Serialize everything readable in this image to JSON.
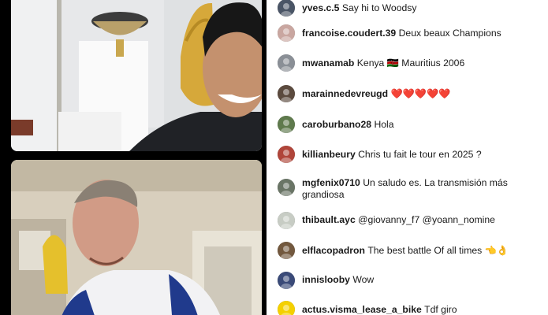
{
  "comments": [
    {
      "user": "yves.c.5",
      "text": "Say hi to Woodsy",
      "avatar_color": "#4a5566"
    },
    {
      "user": "francoise.coudert.39",
      "text": "Deux beaux Champions",
      "avatar_color": "#c9a6a0"
    },
    {
      "user": "mwanamab",
      "text": "Kenya 🇰🇪 Mauritius 2006",
      "avatar_color": "#8a8f96"
    },
    {
      "user": "marainnedevreugd",
      "text": "❤️❤️❤️❤️❤️",
      "avatar_color": "#5b4a3e"
    },
    {
      "user": "caroburbano28",
      "text": "Hola",
      "avatar_color": "#5f7a4d"
    },
    {
      "user": "killianbeury",
      "text": "Chris tu fait le tour en 2025 ?",
      "avatar_color": "#b0453a"
    },
    {
      "user": "mgfenix0710",
      "text": "Un saludo es. La transmisión más grandiosa",
      "avatar_color": "#6a7566"
    },
    {
      "user": "thibault.ayc",
      "text": "@giovanny_f7 @yoann_nomine",
      "avatar_color": "#c7ccc4"
    },
    {
      "user": "elflacopadron",
      "text": "The best battle Of all times 👈👌",
      "avatar_color": "#72583e"
    },
    {
      "user": "innislooby",
      "text": "Wow",
      "avatar_color": "#3a4a78"
    },
    {
      "user": "actus.visma_lease_a_bike",
      "text": "Tdf giro",
      "avatar_color": "#f4d000"
    }
  ]
}
